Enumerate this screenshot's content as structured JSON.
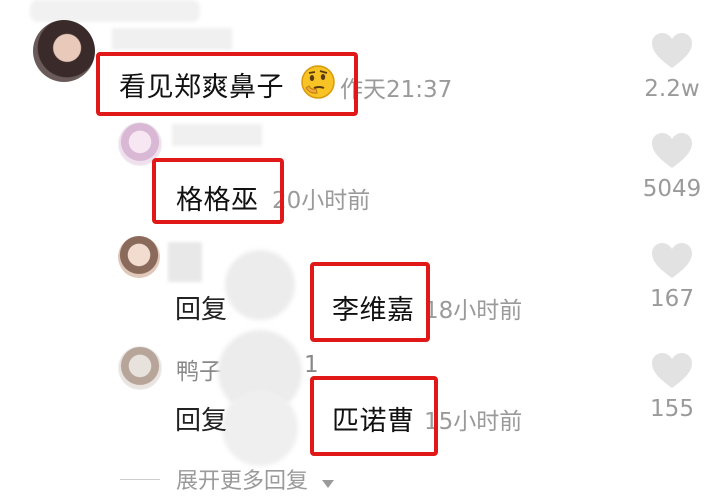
{
  "colors": {
    "accent_red": "#e01818",
    "meta_gray": "#9a9a9a"
  },
  "comments": [
    {
      "text": "看见郑爽鼻子",
      "emoji_icon": "thinking-face-emoji",
      "time": "作天21:37",
      "likes": "2.2w"
    },
    {
      "text": "格格巫",
      "time": "20小时前",
      "likes": "5049"
    },
    {
      "reply_prefix": "回复",
      "text": "李维嘉",
      "time": "18小时前",
      "likes": "167"
    },
    {
      "username": "鸭子",
      "username_suffix": "1",
      "reply_prefix": "回复",
      "text": "匹诺曹",
      "time": "15小时前",
      "likes": "155"
    }
  ],
  "expand_more": "展开更多回复"
}
